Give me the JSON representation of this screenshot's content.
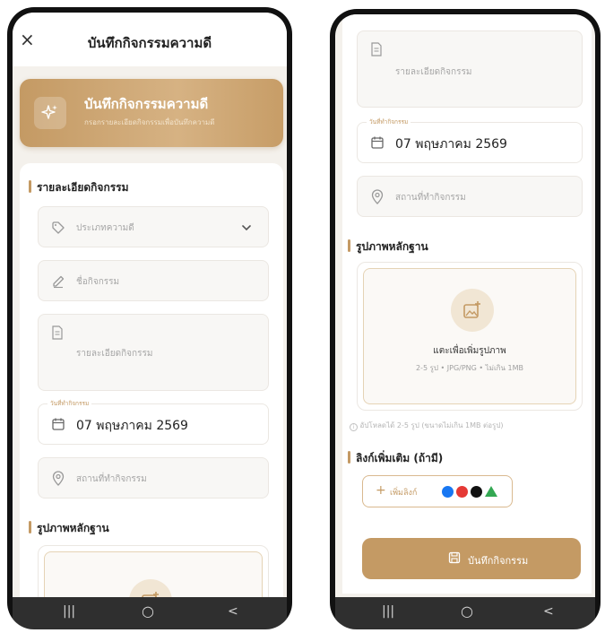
{
  "header": {
    "title": "บันทึกกิจกรรมความดี",
    "close_label": "×"
  },
  "hero": {
    "title": "บันทึกกิจกรรมความดี",
    "subtitle": "กรอกรายละเอียดกิจกรรมเพื่อบันทึกความดี"
  },
  "sections": {
    "details_title": "รายละเอียดกิจกรรม",
    "evidence_title": "รูปภาพหลักฐาน",
    "extra_links_title": "ลิงก์เพิ่มเติม (ถ้ามี)"
  },
  "form": {
    "category_placeholder": "ประเภทความดี",
    "name_placeholder": "ชื่อกิจกรรม",
    "details_placeholder": "รายละเอียดกิจกรรม",
    "date_label": "วันที่ทำกิจกรรม",
    "date_value": "07 พฤษภาคม 2569",
    "place_placeholder": "สถานที่ทำกิจกรรม"
  },
  "upload": {
    "title": "แตะเพื่อเพิ่มรูปภาพ",
    "subtitle": "2-5 รูป • JPG/PNG • ไม่เกิน 1MB",
    "note": "อัปโหลดได้ 2-5 รูป (ขนาดไม่เกิน 1MB ต่อรูป)"
  },
  "links": {
    "add_label": "เพิ่มลิงก์",
    "plus": "+"
  },
  "actions": {
    "save_label": "บันทึกกิจกรรม"
  },
  "nav": {
    "recent": "|||",
    "home": "○",
    "back": "<"
  },
  "colors": {
    "accent": "#c49a64",
    "background": "#f4f1ec",
    "navbar": "#2f2f2f"
  }
}
